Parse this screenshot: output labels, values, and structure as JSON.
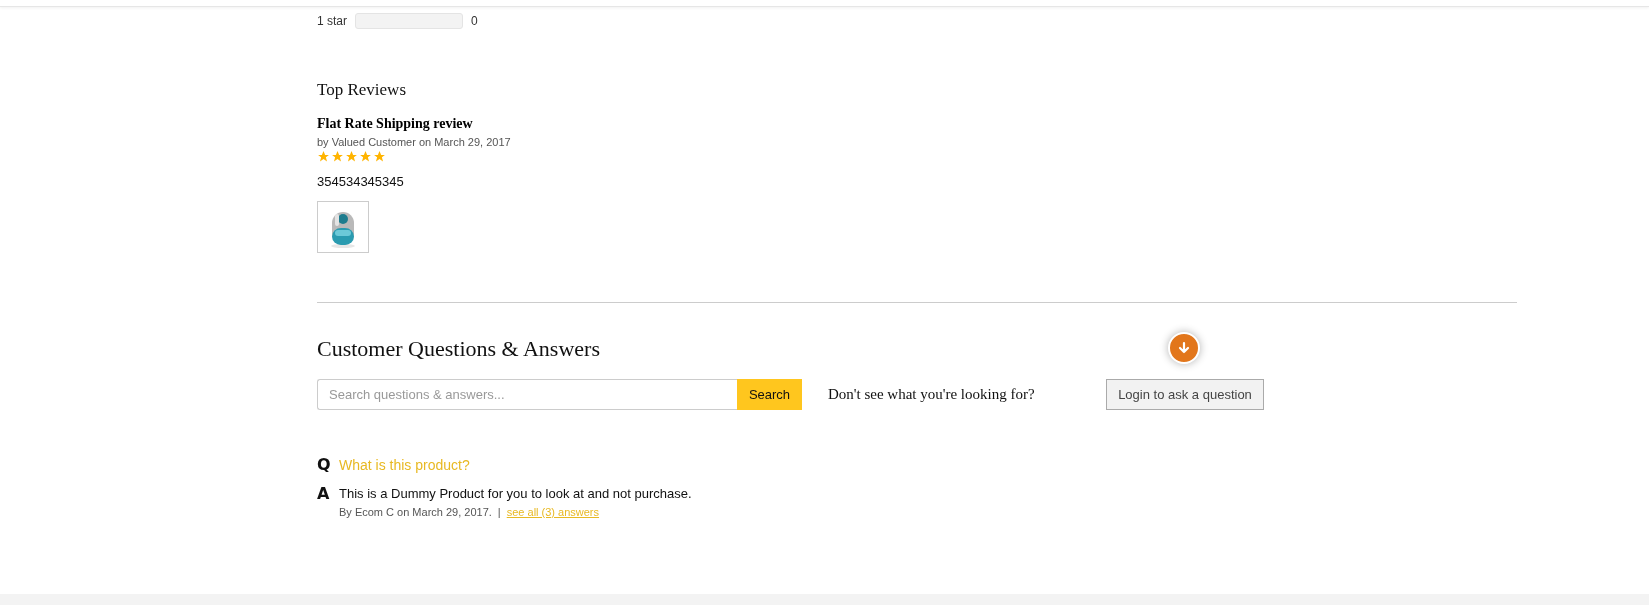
{
  "rating_rows": [
    {
      "label": "1 star",
      "level": 0,
      "count": "0"
    }
  ],
  "top_reviews": {
    "heading": "Top Reviews",
    "reviews": [
      {
        "title": "Flat Rate Shipping review",
        "byline": "by Valued Customer on March 29, 2017",
        "stars": 5,
        "body": "354534345345",
        "images": [
          {
            "kind": "picture"
          }
        ]
      }
    ]
  },
  "qa": {
    "heading": "Customer Questions & Answers",
    "search": {
      "placeholder": "Search questions & answers...",
      "button": "Search"
    },
    "prompt": "Don't see what you're looking for?",
    "login_button": "Login to ask a question",
    "items": [
      {
        "q_mark": "Q",
        "question": "What is this product?",
        "a_mark": "A",
        "answer": "This is a Dummy Product for you to look at and not purchase.",
        "byline": "By Ecom C on March 29, 2017.",
        "separator": "|",
        "link": "see all (3) answers"
      }
    ]
  }
}
